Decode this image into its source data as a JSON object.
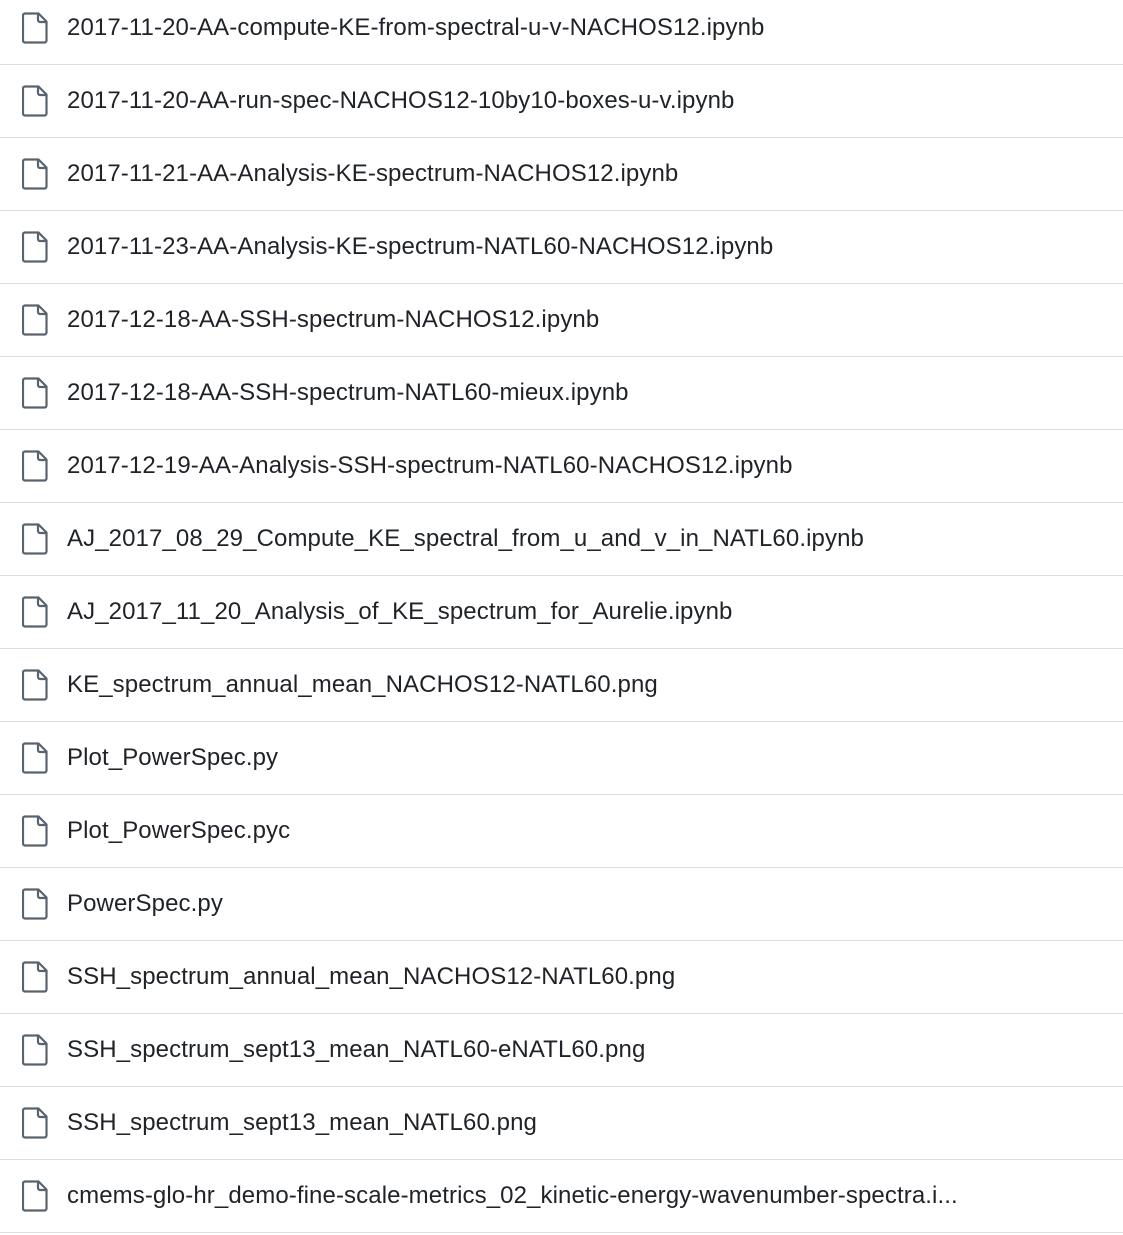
{
  "files": [
    {
      "name": "2017-11-20-AA-compute-KE-from-spectral-u-v-NACHOS12.ipynb",
      "icon": "file-icon"
    },
    {
      "name": "2017-11-20-AA-run-spec-NACHOS12-10by10-boxes-u-v.ipynb",
      "icon": "file-icon"
    },
    {
      "name": "2017-11-21-AA-Analysis-KE-spectrum-NACHOS12.ipynb",
      "icon": "file-icon"
    },
    {
      "name": "2017-11-23-AA-Analysis-KE-spectrum-NATL60-NACHOS12.ipynb",
      "icon": "file-icon"
    },
    {
      "name": "2017-12-18-AA-SSH-spectrum-NACHOS12.ipynb",
      "icon": "file-icon"
    },
    {
      "name": "2017-12-18-AA-SSH-spectrum-NATL60-mieux.ipynb",
      "icon": "file-icon"
    },
    {
      "name": "2017-12-19-AA-Analysis-SSH-spectrum-NATL60-NACHOS12.ipynb",
      "icon": "file-icon"
    },
    {
      "name": "AJ_2017_08_29_Compute_KE_spectral_from_u_and_v_in_NATL60.ipynb",
      "icon": "file-icon"
    },
    {
      "name": "AJ_2017_11_20_Analysis_of_KE_spectrum_for_Aurelie.ipynb",
      "icon": "file-icon"
    },
    {
      "name": "KE_spectrum_annual_mean_NACHOS12-NATL60.png",
      "icon": "file-icon"
    },
    {
      "name": "Plot_PowerSpec.py",
      "icon": "file-icon"
    },
    {
      "name": "Plot_PowerSpec.pyc",
      "icon": "file-icon"
    },
    {
      "name": "PowerSpec.py",
      "icon": "file-icon"
    },
    {
      "name": "SSH_spectrum_annual_mean_NACHOS12-NATL60.png",
      "icon": "file-icon"
    },
    {
      "name": "SSH_spectrum_sept13_mean_NATL60-eNATL60.png",
      "icon": "file-icon"
    },
    {
      "name": "SSH_spectrum_sept13_mean_NATL60.png",
      "icon": "file-icon"
    },
    {
      "name": "cmems-glo-hr_demo-fine-scale-metrics_02_kinetic-energy-wavenumber-spectra.i...",
      "icon": "file-icon"
    }
  ],
  "colors": {
    "text": "#1f2328",
    "icon": "#59636e",
    "divider": "#d8dee4",
    "background": "#ffffff"
  }
}
